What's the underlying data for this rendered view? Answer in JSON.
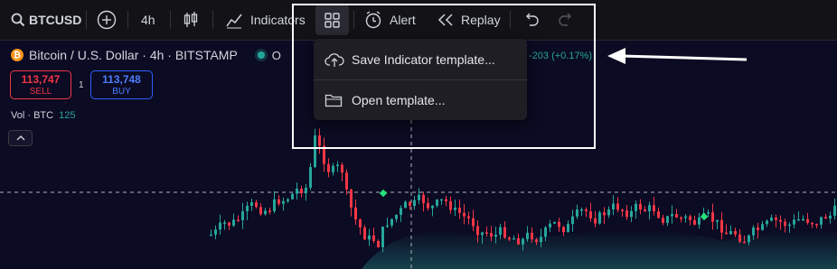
{
  "toolbar": {
    "symbol": "BTCUSD",
    "interval": "4h",
    "indicators_label": "Indicators",
    "alert_label": "Alert",
    "replay_label": "Replay"
  },
  "legend": {
    "title": "Bitcoin / U.S. Dollar · 4h · BITSTAMP",
    "ohlc_prefix": "O",
    "change": "-203 (+0.17%)"
  },
  "trade": {
    "sell_price": "113,747",
    "sell_label": "SELL",
    "spread": "1",
    "buy_price": "113,748",
    "buy_label": "BUY"
  },
  "volume": {
    "label": "Vol · BTC",
    "value": "125"
  },
  "menu": {
    "save_label": "Save Indicator template...",
    "open_label": "Open template..."
  },
  "colors": {
    "up": "#26a69a",
    "down": "#f23645",
    "background": "#0b0b23"
  },
  "icons": [
    "search-icon",
    "add-symbol-icon",
    "candles-icon",
    "indicators-icon",
    "templates-icon",
    "alert-icon",
    "replay-icon",
    "undo-icon",
    "redo-icon",
    "cloud-upload-icon",
    "folder-icon",
    "arrow-icon"
  ]
}
